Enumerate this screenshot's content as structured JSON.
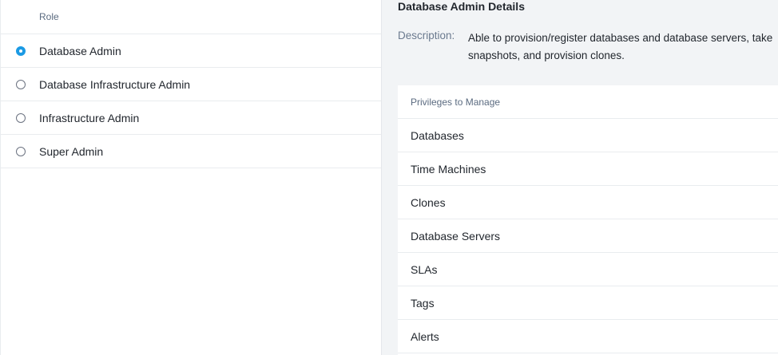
{
  "roles_table": {
    "header": "Role",
    "roles": [
      {
        "label": "Database Admin",
        "selected": true
      },
      {
        "label": "Database Infrastructure Admin",
        "selected": false
      },
      {
        "label": "Infrastructure Admin",
        "selected": false
      },
      {
        "label": "Super Admin",
        "selected": false
      }
    ]
  },
  "details": {
    "title": "Database Admin Details",
    "description_label": "Description:",
    "description": "Able to provision/register databases and database servers, take snapshots, and provision clones.",
    "privileges_header": "Privileges to Manage",
    "privileges": [
      "Databases",
      "Time Machines",
      "Clones",
      "Database Servers",
      "SLAs",
      "Tags",
      "Alerts"
    ]
  },
  "colors": {
    "accent": "#1b9ae4",
    "panel_bg": "#f2f4f6"
  }
}
